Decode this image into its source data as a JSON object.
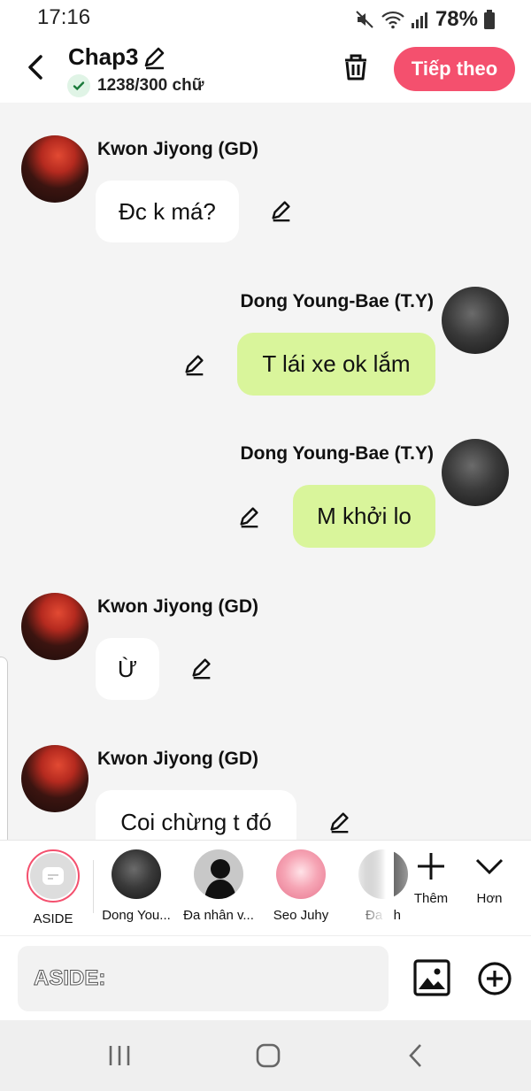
{
  "status_bar": {
    "time": "17:16",
    "battery": "78%",
    "icons": [
      "mute-icon",
      "wifi-icon",
      "signal-icon",
      "battery-icon"
    ]
  },
  "header": {
    "title": "Chap3",
    "word_count": "1238/300 chữ",
    "next_label": "Tiếp theo",
    "accent_color": "#f4506e"
  },
  "messages": [
    {
      "sender": "Kwon Jiyong (GD)",
      "text": "Đc k má?",
      "side": "left"
    },
    {
      "sender": "Dong Young-Bae (T.Y)",
      "text": "T lái xe ok lắm",
      "side": "right"
    },
    {
      "sender": "Dong Young-Bae (T.Y)",
      "text": "M khởi lo",
      "side": "right"
    },
    {
      "sender": "Kwon Jiyong (GD)",
      "text": "Ừ",
      "side": "left"
    },
    {
      "sender": "Kwon Jiyong (GD)",
      "text": "Coi chừng t đó",
      "side": "left"
    }
  ],
  "characters": {
    "items": [
      {
        "label": "ASIDE"
      },
      {
        "label": "Dong You..."
      },
      {
        "label": "Đa nhân v..."
      },
      {
        "label": "Seo Juhy"
      },
      {
        "label": "Đa nh"
      }
    ],
    "more_label": "Thêm",
    "collapse_label": "Hơn"
  },
  "composer": {
    "placeholder": "ASIDE:"
  },
  "colors": {
    "left_bubble": "#ffffff",
    "right_bubble": "#d9f59b",
    "background": "#f4f4f4"
  }
}
